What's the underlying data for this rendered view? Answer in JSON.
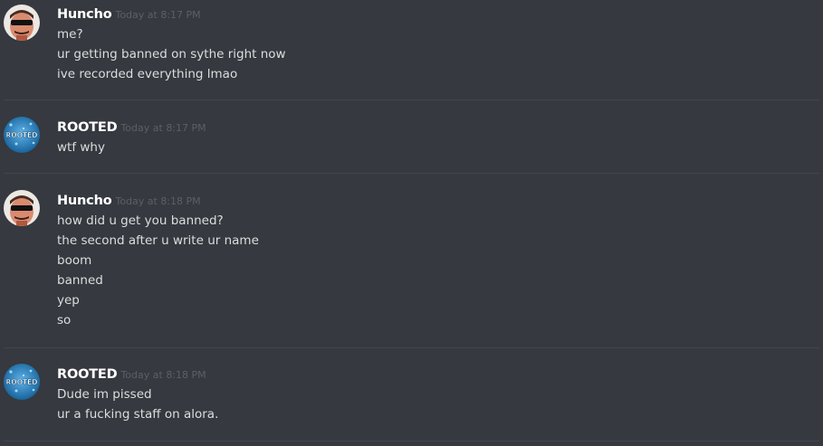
{
  "messages": [
    {
      "author": "Huncho",
      "timestamp": "Today at 8:17 PM",
      "avatar_icon": "huncho-avatar-icon",
      "lines": [
        "me?",
        "ur getting banned on sythe right now",
        "ive recorded everything lmao"
      ]
    },
    {
      "author": "ROOTED",
      "timestamp": "Today at 8:17 PM",
      "avatar_icon": "rooted-avatar-icon",
      "avatar_text": "ROOTED",
      "lines": [
        "wtf why"
      ]
    },
    {
      "author": "Huncho",
      "timestamp": "Today at 8:18 PM",
      "avatar_icon": "huncho-avatar-icon",
      "lines": [
        "how did u get you banned?",
        "the second after u write ur name",
        "boom",
        "banned",
        "yep",
        "so"
      ]
    },
    {
      "author": "ROOTED",
      "timestamp": "Today at 8:18 PM",
      "avatar_icon": "rooted-avatar-icon",
      "avatar_text": "ROOTED",
      "lines": [
        "Dude im pissed",
        "ur a fucking staff on alora."
      ]
    }
  ],
  "colors": {
    "background": "#36393f",
    "username": "#ffffff",
    "timestamp": "#5c5f66",
    "message_text": "#dcddde",
    "divider": "#42454b"
  }
}
